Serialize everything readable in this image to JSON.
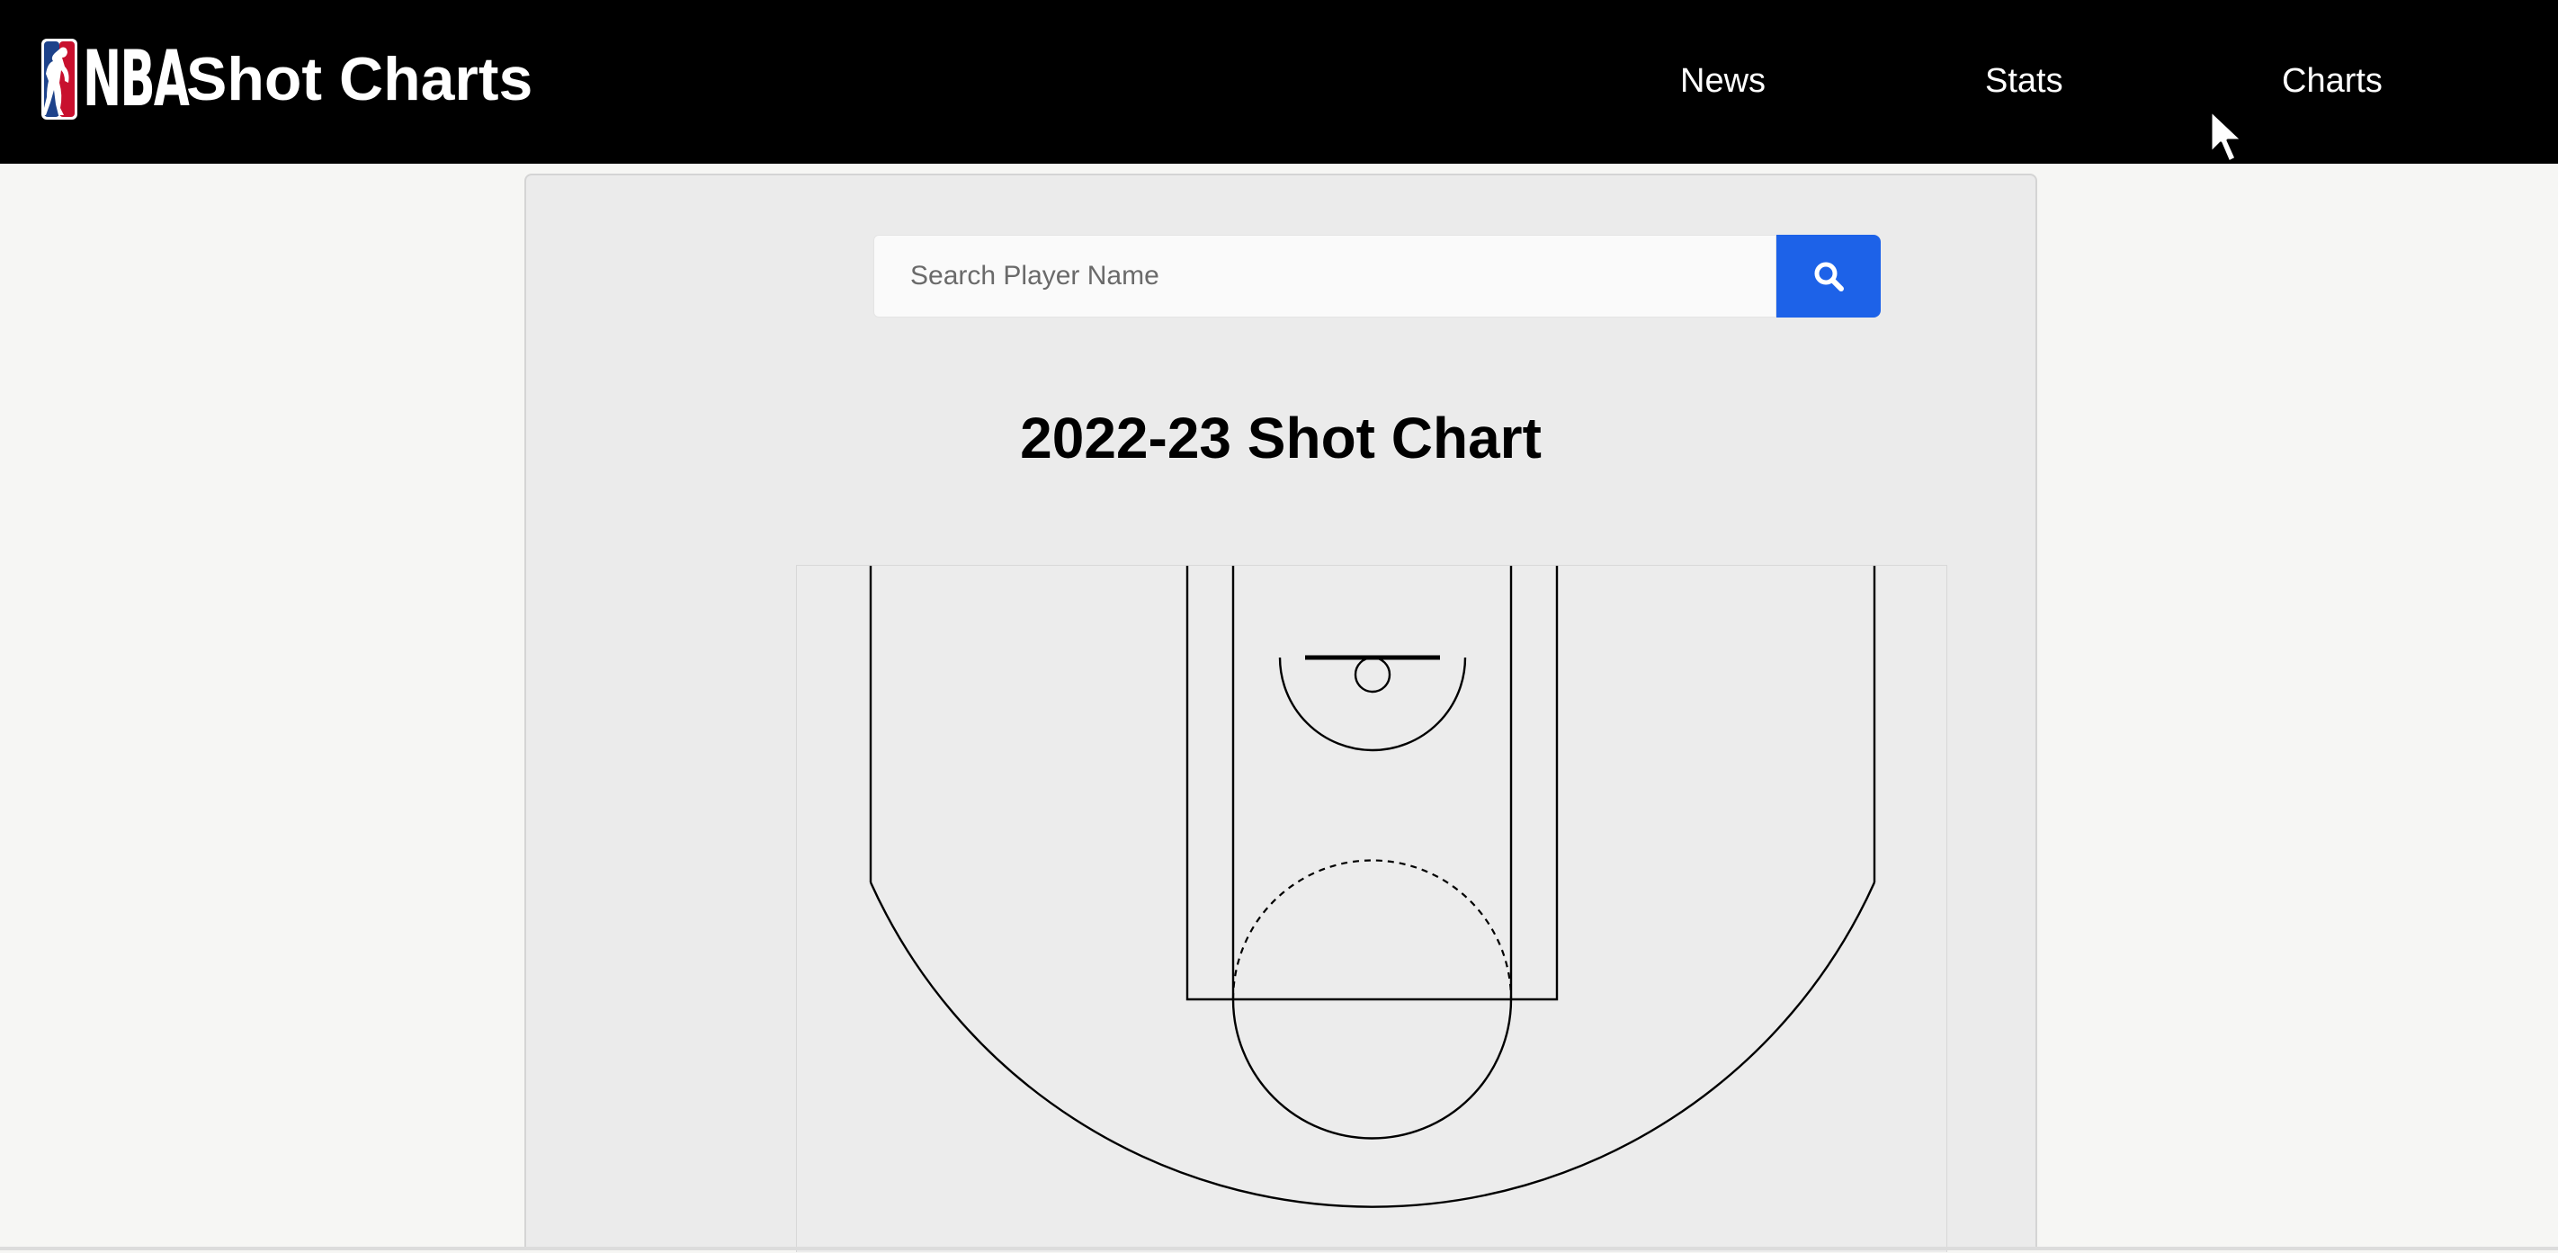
{
  "header": {
    "logo_text": "NBA",
    "title": "Shot Charts",
    "nav": [
      {
        "label": "News"
      },
      {
        "label": "Stats"
      },
      {
        "label": "Charts"
      }
    ]
  },
  "search": {
    "placeholder": "Search Player Name",
    "value": "",
    "button_icon": "search-icon"
  },
  "chart": {
    "title": "2022-23 Shot Chart"
  },
  "colors": {
    "header_bg": "#000000",
    "accent": "#1d62e8",
    "panel_bg": "#ebebeb",
    "page_bg": "#f6f6f4"
  }
}
